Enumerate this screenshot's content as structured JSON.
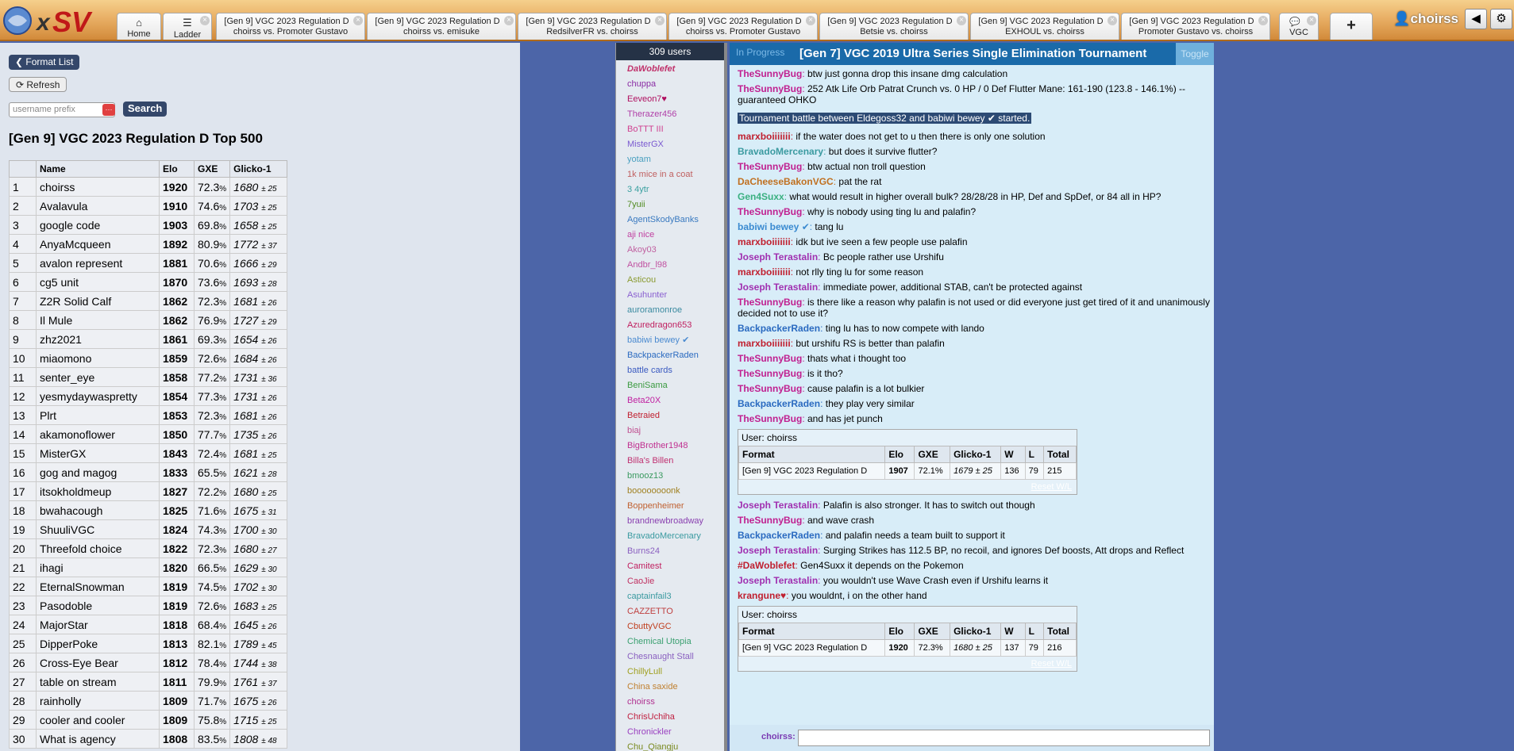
{
  "app": {
    "logo": "PS",
    "user": "choirss"
  },
  "colors": {
    "topbar": "#e9b066",
    "accent": "#34476a",
    "chatbar": "#1a6aa9"
  },
  "tabs": [
    {
      "l1": "Home",
      "icon": "home-icon"
    },
    {
      "l1": "Ladder",
      "icon": "list-icon"
    },
    {
      "l1": "[Gen 9] VGC 2023 Regulation D",
      "l2": "choirss vs. Promoter Gustavo"
    },
    {
      "l1": "[Gen 9] VGC 2023 Regulation D",
      "l2": "choirss vs. emisuke"
    },
    {
      "l1": "[Gen 9] VGC 2023 Regulation D",
      "l2": "RedsilverFR vs. choirss"
    },
    {
      "l1": "[Gen 9] VGC 2023 Regulation D",
      "l2": "choirss vs. Promoter Gustavo"
    },
    {
      "l1": "[Gen 9] VGC 2023 Regulation D",
      "l2": "Betsie vs. choirss"
    },
    {
      "l1": "[Gen 9] VGC 2023 Regulation D",
      "l2": "EXHOUL vs. choirss"
    },
    {
      "l1": "[Gen 9] VGC 2023 Regulation D",
      "l2": "Promoter Gustavo vs. choirss"
    },
    {
      "l1": "VGC"
    }
  ],
  "ladder": {
    "format_list": "Format List",
    "refresh": "Refresh",
    "search_ph": "username prefix",
    "search_btn": "Search",
    "title": "[Gen 9] VGC 2023 Regulation D Top 500",
    "headers": [
      "",
      "Name",
      "Elo",
      "GXE",
      "Glicko-1"
    ],
    "rows": [
      [
        "1",
        "choirss",
        "1920",
        "72.3",
        "%",
        "1680",
        "± 25"
      ],
      [
        "2",
        "Avalavula",
        "1910",
        "74.6",
        "%",
        "1703",
        "± 25"
      ],
      [
        "3",
        "google code",
        "1903",
        "69.8",
        "%",
        "1658",
        "± 25"
      ],
      [
        "4",
        "AnyaMcqueen",
        "1892",
        "80.9",
        "%",
        "1772",
        "± 37"
      ],
      [
        "5",
        "avalon represent",
        "1881",
        "70.6",
        "%",
        "1666",
        "± 29"
      ],
      [
        "6",
        "cg5 unit",
        "1870",
        "73.6",
        "%",
        "1693",
        "± 28"
      ],
      [
        "7",
        "Z2R Solid Calf",
        "1862",
        "72.3",
        "%",
        "1681",
        "± 26"
      ],
      [
        "8",
        "Il Mule",
        "1862",
        "76.9",
        "%",
        "1727",
        "± 29"
      ],
      [
        "9",
        "zhz2021",
        "1861",
        "69.3",
        "%",
        "1654",
        "± 26"
      ],
      [
        "10",
        "miaomono",
        "1859",
        "72.6",
        "%",
        "1684",
        "± 26"
      ],
      [
        "11",
        "senter_eye",
        "1858",
        "77.2",
        "%",
        "1731",
        "± 36"
      ],
      [
        "12",
        "yesmydaywaspretty",
        "1854",
        "77.3",
        "%",
        "1731",
        "± 26"
      ],
      [
        "13",
        "Plrt",
        "1853",
        "72.3",
        "%",
        "1681",
        "± 26"
      ],
      [
        "14",
        "akamonoflower",
        "1850",
        "77.7",
        "%",
        "1735",
        "± 26"
      ],
      [
        "15",
        "MisterGX",
        "1843",
        "72.4",
        "%",
        "1681",
        "± 25"
      ],
      [
        "16",
        "gog and magog",
        "1833",
        "65.5",
        "%",
        "1621",
        "± 28"
      ],
      [
        "17",
        "itsokholdmeup",
        "1827",
        "72.2",
        "%",
        "1680",
        "± 25"
      ],
      [
        "18",
        "bwahacough",
        "1825",
        "71.6",
        "%",
        "1675",
        "± 31"
      ],
      [
        "19",
        "ShuuliVGC",
        "1824",
        "74.3",
        "%",
        "1700",
        "± 30"
      ],
      [
        "20",
        "Threefold choice",
        "1822",
        "72.3",
        "%",
        "1680",
        "± 27"
      ],
      [
        "21",
        "ihagi",
        "1820",
        "66.5",
        "%",
        "1629",
        "± 30"
      ],
      [
        "22",
        "EternalSnowman",
        "1819",
        "74.5",
        "%",
        "1702",
        "± 30"
      ],
      [
        "23",
        "Pasodoble",
        "1819",
        "72.6",
        "%",
        "1683",
        "± 25"
      ],
      [
        "24",
        "MajorStar",
        "1818",
        "68.4",
        "%",
        "1645",
        "± 26"
      ],
      [
        "25",
        "DipperPoke",
        "1813",
        "82.1",
        "%",
        "1789",
        "± 45"
      ],
      [
        "26",
        "Cross-Eye Bear",
        "1812",
        "78.4",
        "%",
        "1744",
        "± 38"
      ],
      [
        "27",
        "table on stream",
        "1811",
        "79.9",
        "%",
        "1761",
        "± 37"
      ],
      [
        "28",
        "rainholly",
        "1809",
        "71.7",
        "%",
        "1675",
        "± 26"
      ],
      [
        "29",
        "cooler and cooler",
        "1809",
        "75.8",
        "%",
        "1715",
        "± 25"
      ],
      [
        "30",
        "What is agency",
        "1808",
        "83.5",
        "%",
        "1808",
        "± 48"
      ]
    ]
  },
  "users": {
    "count": "309 users",
    "list": [
      [
        "DaWoblefet",
        "#c0306a"
      ],
      [
        "chuppa",
        "#8a2ca4"
      ],
      [
        "Eeveon7♥",
        "#b01060"
      ],
      [
        "Therazer456",
        "#b040a8"
      ],
      [
        "BoTTT III",
        "#d04090"
      ],
      [
        "MisterGX",
        "#7a5ad0"
      ],
      [
        "yotam",
        "#4aa0c0"
      ],
      [
        "1k mice in a coat",
        "#c06060"
      ],
      [
        "3 4ytr",
        "#3aa0a0"
      ],
      [
        "7yuii",
        "#508a20"
      ],
      [
        "AgentSkodyBanks",
        "#3a7ac0"
      ],
      [
        "aji nice",
        "#c040a0"
      ],
      [
        "Akoy03",
        "#c060a0"
      ],
      [
        "Andbr_l98",
        "#c050a0"
      ],
      [
        "Asticou",
        "#8a9a30"
      ],
      [
        "Asuhunter",
        "#8a60d0"
      ],
      [
        "auroramonroe",
        "#3a8aa0"
      ],
      [
        "Azuredragon653",
        "#c02060"
      ],
      [
        "babiwi bewey ✔",
        "#4a8ad0"
      ],
      [
        "BackpackerRaden",
        "#2a6ac0"
      ],
      [
        "battle cards",
        "#3a5ac0"
      ],
      [
        "BeniSama",
        "#3a9a40"
      ],
      [
        "Beta20X",
        "#c020a0"
      ],
      [
        "Betraied",
        "#c02030"
      ],
      [
        "biaj",
        "#c05090"
      ],
      [
        "BigBrother1948",
        "#c03090"
      ],
      [
        "Billa's Billen",
        "#c03070"
      ],
      [
        "bmooz13",
        "#3a9a60"
      ],
      [
        "boooooooonk",
        "#a08020"
      ],
      [
        "Boppenheimer",
        "#c06030"
      ],
      [
        "brandnewbroadway",
        "#8a40b0"
      ],
      [
        "BravadoMercenary",
        "#3a9aa0"
      ],
      [
        "Burns24",
        "#8a60c0"
      ],
      [
        "Camitest",
        "#c02060"
      ],
      [
        "CaoJie",
        "#c03060"
      ],
      [
        "captainfail3",
        "#3a9aa0"
      ],
      [
        "CAZZETTO",
        "#c04040"
      ],
      [
        "CbuttyVGC",
        "#c04020"
      ],
      [
        "Chemical Utopia",
        "#3aa070"
      ],
      [
        "Chesnaught Stall",
        "#8a60c0"
      ],
      [
        "ChillyLull",
        "#a0a020"
      ],
      [
        "China saxide",
        "#c08030"
      ],
      [
        "choirss",
        "#b03090"
      ],
      [
        "ChrisUchiha",
        "#c02040"
      ],
      [
        "Chronickler",
        "#9a40c0"
      ],
      [
        "Chu_Qiangju",
        "#7a8a20"
      ]
    ]
  },
  "chat": {
    "status": "In Progress",
    "title": "[Gen 7] VGC 2019 Ultra Series Single Elimination Tournament",
    "toggle": "Toggle",
    "messages": [
      {
        "u": "TheSunnyBug",
        "c": "#c02090",
        "t": "btw just gonna drop this insane dmg calculation"
      },
      {
        "u": "TheSunnyBug",
        "c": "#c02090",
        "t": "252 Atk Life Orb Patrat Crunch vs. 0 HP / 0 Def Flutter Mane: 161-190 (123.8 - 146.1%) -- guaranteed OHKO"
      },
      {
        "sys": "Tournament battle between Eldegoss32 and babiwi bewey ✔ started."
      },
      {
        "u": "marxboiiiiiii",
        "c": "#c02030",
        "t": "if the water does not get to u then there is only one solution"
      },
      {
        "u": "BravadoMercenary",
        "c": "#3a9aa0",
        "t": "but does it survive flutter?"
      },
      {
        "u": "TheSunnyBug",
        "c": "#c02090",
        "t": "btw actual non troll question"
      },
      {
        "u": "DaCheeseBakonVGC",
        "c": "#c07020",
        "t": "pat the rat"
      },
      {
        "u": "Gen4Suxx",
        "c": "#3ab080",
        "t": "what would result in higher overall bulk? 28/28/28 in HP, Def and SpDef, or 84 all in HP?"
      },
      {
        "u": "TheSunnyBug",
        "c": "#c02090",
        "t": "why is nobody using ting lu and palafin?"
      },
      {
        "u": "babiwi bewey ✔",
        "c": "#3a8ad0",
        "t": "tang lu"
      },
      {
        "u": "marxboiiiiiii",
        "c": "#c02030",
        "t": "idk but ive seen a few people use palafin"
      },
      {
        "u": "Joseph Terastalin",
        "c": "#a030b0",
        "t": "Bc people rather use Urshifu"
      },
      {
        "u": "marxboiiiiiii",
        "c": "#c02030",
        "t": "not rlly ting lu for some reason"
      },
      {
        "u": "Joseph Terastalin",
        "c": "#a030b0",
        "t": "immediate power, additional STAB, can't be protected against"
      },
      {
        "u": "TheSunnyBug",
        "c": "#c02090",
        "t": "is there like a reason why palafin is not used or did everyone just get tired of it and unanimously decided not to use it?"
      },
      {
        "u": "BackpackerRaden",
        "c": "#2a6ac0",
        "t": "ting lu has to now compete with lando"
      },
      {
        "u": "marxboiiiiiii",
        "c": "#c02030",
        "t": "but urshifu RS is better than palafin"
      },
      {
        "u": "TheSunnyBug",
        "c": "#c02090",
        "t": "thats what i thought too"
      },
      {
        "u": "TheSunnyBug",
        "c": "#c02090",
        "t": "is it tho?"
      },
      {
        "u": "TheSunnyBug",
        "c": "#c02090",
        "t": "cause palafin is a lot bulkier"
      },
      {
        "u": "BackpackerRaden",
        "c": "#2a6ac0",
        "t": "they play very similar"
      },
      {
        "u": "TheSunnyBug",
        "c": "#c02090",
        "t": "and has jet punch"
      },
      {
        "box": {
          "user": "User: choirss",
          "head": [
            "Format",
            "Elo",
            "GXE",
            "Glicko-1",
            "W",
            "L",
            "Total"
          ],
          "row": [
            "[Gen 9] VGC 2023 Regulation D",
            "1907",
            "72.1%",
            "1679 ± 25",
            "136",
            "79",
            "215"
          ],
          "reset": "Reset W/L"
        }
      },
      {
        "u": "Joseph Terastalin",
        "c": "#a030b0",
        "t": "Palafin is also stronger. It has to switch out though"
      },
      {
        "u": "TheSunnyBug",
        "c": "#c02090",
        "t": "and wave crash"
      },
      {
        "u": "BackpackerRaden",
        "c": "#2a6ac0",
        "t": "and palafin needs a team built to support it"
      },
      {
        "u": "Joseph Terastalin",
        "c": "#a030b0",
        "t": "Surging Strikes has 112.5 BP, no recoil, and ignores Def boosts, Att drops and Reflect"
      },
      {
        "u": "#DaWoblefet",
        "c": "#c02030",
        "t": "Gen4Suxx it depends on the Pokemon"
      },
      {
        "u": "Joseph Terastalin",
        "c": "#a030b0",
        "t": "you wouldn't use Wave Crash even if Urshifu learns it"
      },
      {
        "u": "krangune♥",
        "c": "#c02030",
        "t": "you wouldnt, i on the other hand"
      },
      {
        "box": {
          "user": "User: choirss",
          "head": [
            "Format",
            "Elo",
            "GXE",
            "Glicko-1",
            "W",
            "L",
            "Total"
          ],
          "row": [
            "[Gen 9] VGC 2023 Regulation D",
            "1920",
            "72.3%",
            "1680 ± 25",
            "137",
            "79",
            "216"
          ],
          "reset": "Reset W/L"
        }
      }
    ],
    "input_user": "choirss:"
  }
}
